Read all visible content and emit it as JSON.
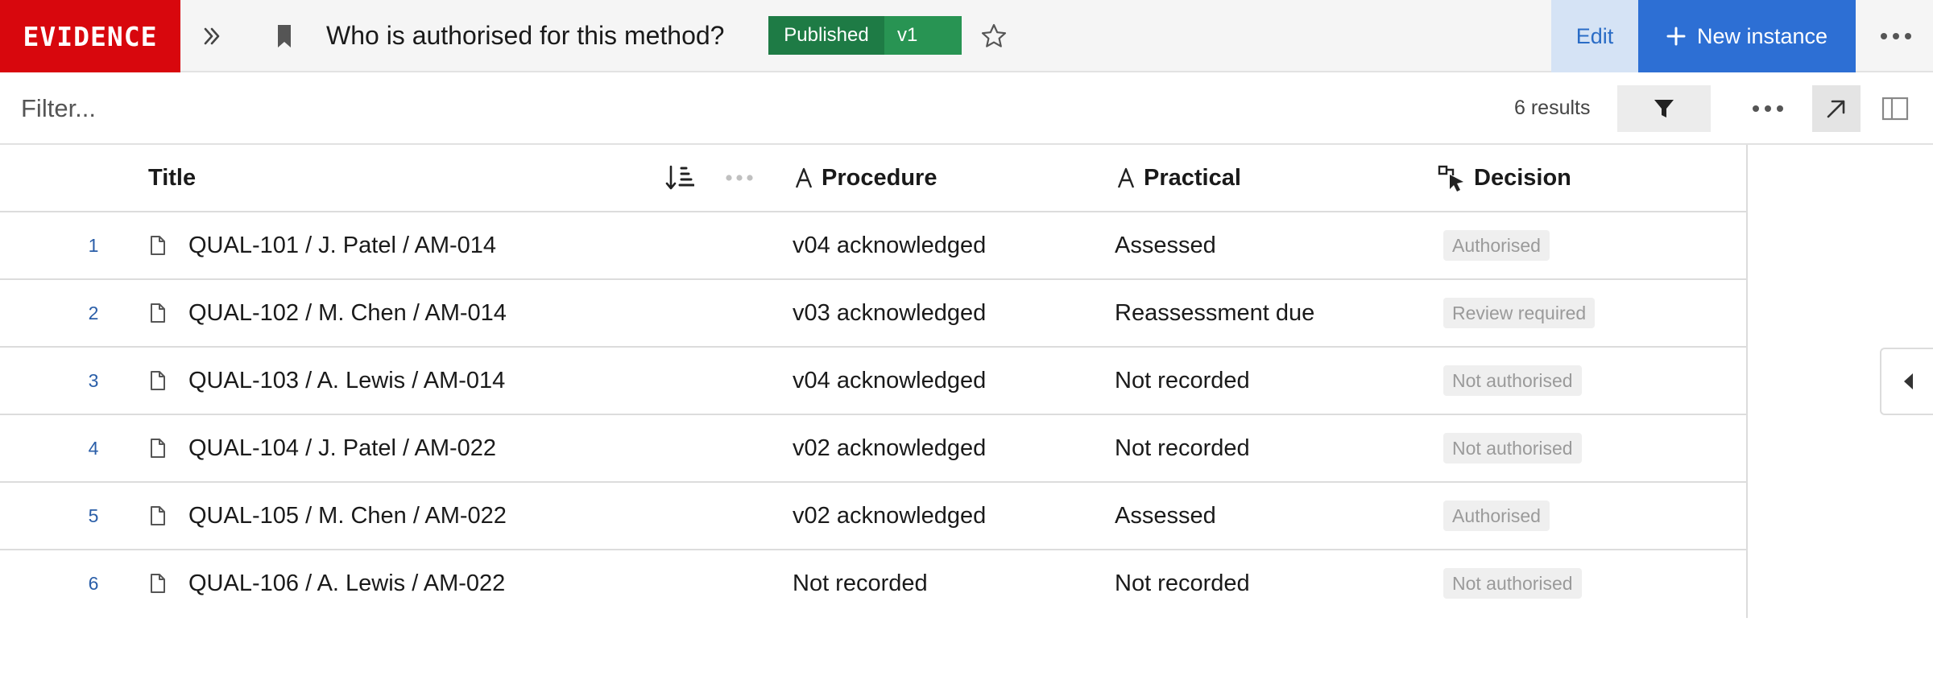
{
  "header": {
    "brand": "EVIDENCE",
    "title": "Who is authorised for this method?",
    "status_badge": "Published",
    "version_badge": "v1",
    "edit_label": "Edit",
    "new_instance_label": "New instance",
    "icons": {
      "expand": "double-chevron-right-icon",
      "bookmark": "bookmark-icon",
      "favorite": "star-icon",
      "new": "plus-icon",
      "more": "more-horizontal-icon"
    },
    "colors": {
      "brand": "#d8070d",
      "published": "#1e7b45",
      "version": "#289453",
      "primary": "#2d6fd4",
      "edit_bg": "#d5e3f5"
    }
  },
  "filterbar": {
    "placeholder": "Filter...",
    "results": "6 results",
    "icons": {
      "filter": "funnel-icon",
      "more": "more-horizontal-icon",
      "open": "arrow-up-right-icon",
      "panel": "side-panel-icon"
    }
  },
  "table": {
    "columns": [
      {
        "label": "Title",
        "icon": ""
      },
      {
        "label": "Procedure",
        "icon": "text-type-icon"
      },
      {
        "label": "Practical",
        "icon": "text-type-icon"
      },
      {
        "label": "Decision",
        "icon": "decision-cursor-icon"
      }
    ],
    "rows": [
      {
        "n": "1",
        "title": "QUAL-101 / J. Patel / AM-014",
        "procedure": "v04 acknowledged",
        "practical": "Assessed",
        "decision": "Authorised"
      },
      {
        "n": "2",
        "title": "QUAL-102 / M. Chen / AM-014",
        "procedure": "v03 acknowledged",
        "practical": "Reassessment due",
        "decision": "Review required"
      },
      {
        "n": "3",
        "title": "QUAL-103 / A. Lewis / AM-014",
        "procedure": "v04 acknowledged",
        "practical": "Not recorded",
        "decision": "Not authorised"
      },
      {
        "n": "4",
        "title": "QUAL-104 / J. Patel / AM-022",
        "procedure": "v02 acknowledged",
        "practical": "Not recorded",
        "decision": "Not authorised"
      },
      {
        "n": "5",
        "title": "QUAL-105 / M. Chen / AM-022",
        "procedure": "v02 acknowledged",
        "practical": "Assessed",
        "decision": "Authorised"
      },
      {
        "n": "6",
        "title": "QUAL-106 / A. Lewis / AM-022",
        "procedure": "Not recorded",
        "practical": "Not recorded",
        "decision": "Not authorised"
      }
    ]
  }
}
